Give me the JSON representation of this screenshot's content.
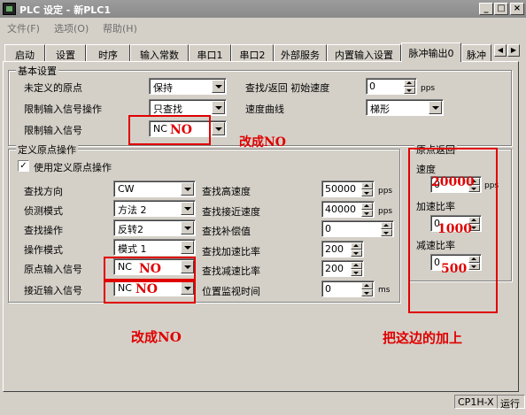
{
  "window": {
    "title": "PLC 设定 - 新PLC1",
    "min": "_",
    "max": "□",
    "close": "×"
  },
  "menu": [
    "文件(F)",
    "选项(O)",
    "帮助(H)"
  ],
  "tabs": [
    "启动",
    "设置",
    "时序",
    "输入常数",
    "串口1",
    "串口2",
    "外部服务",
    "内置输入设置",
    "脉冲输出0",
    "脉冲"
  ],
  "basic": {
    "legend": "基本设置",
    "undefined_origin_label": "未定义的原点",
    "undefined_origin_value": "保持",
    "limit_signal_op_label": "限制输入信号操作",
    "limit_signal_op_value": "只查找",
    "limit_signal_label": "限制输入信号",
    "limit_signal_value": "NC",
    "search_return_label": "查找/返回 初始速度",
    "search_return_value": "0",
    "search_return_unit": "pps",
    "speed_curve_label": "速度曲线",
    "speed_curve_value": "梯形"
  },
  "origin": {
    "legend": "定义原点操作",
    "use_label": "使用定义原点操作",
    "use_checked": "✓",
    "rows_left": [
      {
        "label": "查找方向",
        "value": "CW"
      },
      {
        "label": "侦测模式",
        "value": "方法 2"
      },
      {
        "label": "查找操作",
        "value": "反转2"
      },
      {
        "label": "操作模式",
        "value": "模式 1"
      },
      {
        "label": "原点输入信号",
        "value": "NC"
      },
      {
        "label": "接近输入信号",
        "value": "NC"
      }
    ],
    "rows_right": [
      {
        "label": "查找高速度",
        "value": "50000",
        "unit": "pps"
      },
      {
        "label": "查找接近速度",
        "value": "40000",
        "unit": "pps"
      },
      {
        "label": "查找补偿值",
        "value": "0",
        "unit": ""
      },
      {
        "label": "查找加速比率",
        "value": "200",
        "unit": ""
      },
      {
        "label": "查找减速比率",
        "value": "200",
        "unit": ""
      },
      {
        "label": "位置监视时间",
        "value": "0",
        "unit": "ms"
      }
    ]
  },
  "return": {
    "legend": "原点返回",
    "speed_label": "速度",
    "speed_value": "0",
    "speed_unit": "pps",
    "accel_label": "加速比率",
    "accel_value": "0",
    "decel_label": "减速比率",
    "decel_value": "0"
  },
  "annotations": {
    "no1": "NO",
    "no2": "NO",
    "no3": "NO",
    "change_no_top": "改成NO",
    "change_no_bottom": "改成NO",
    "speed_20000": "20000",
    "accel_1000": "1000",
    "decel_500": "500",
    "add_here": "把这边的加上"
  },
  "status": {
    "model": "CP1H-X",
    "mode": "运行"
  }
}
